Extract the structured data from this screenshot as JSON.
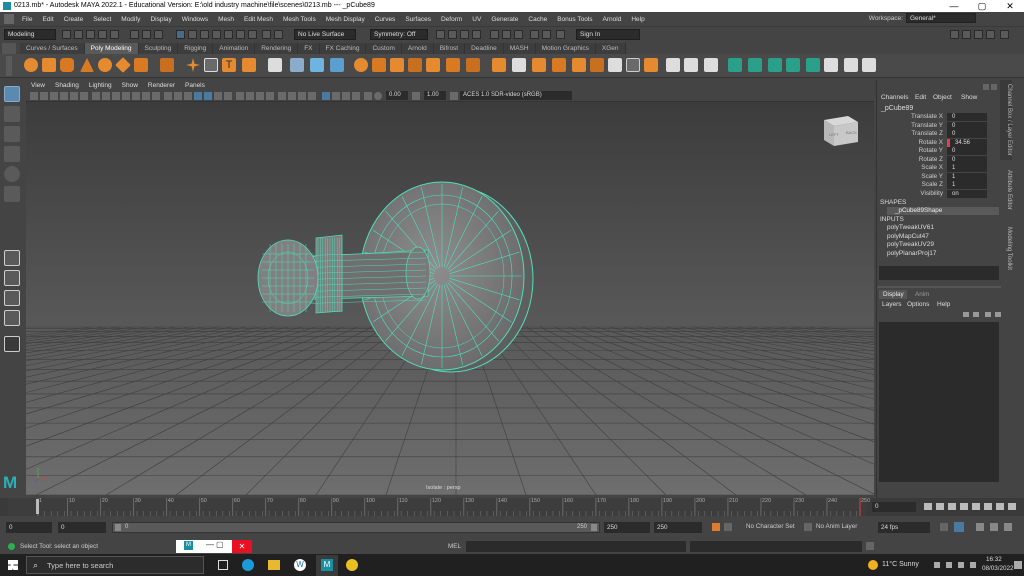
{
  "window": {
    "title": "0213.mb* - Autodesk MAYA 2022.1 - Educational Version: E:\\old industry machine\\file\\scenes\\0213.mb  ---  _pCube89",
    "minimize": "—",
    "maximize": "▢",
    "close": "✕"
  },
  "menubar": {
    "items": [
      "File",
      "Edit",
      "Create",
      "Select",
      "Modify",
      "Display",
      "Windows",
      "Mesh",
      "Edit Mesh",
      "Mesh Tools",
      "Mesh Display",
      "Curves",
      "Surfaces",
      "Deform",
      "UV",
      "Generate",
      "Cache",
      "Bonus Tools",
      "Arnold",
      "Help"
    ],
    "workspace_label": "Workspace:",
    "workspace_value": "General*"
  },
  "statusline": {
    "mode": "Modeling",
    "live_surface": "No Live Surface",
    "symmetry": "Symmetry: Off",
    "signin": "Sign In"
  },
  "shelf": {
    "tabs": [
      "Curves / Surfaces",
      "Poly Modeling",
      "Sculpting",
      "Rigging",
      "Animation",
      "Rendering",
      "FX",
      "FX Caching",
      "Custom",
      "Arnold",
      "Bifrost",
      "Deadline",
      "MASH",
      "Motion Graphics",
      "XGen"
    ],
    "active_tab": "Poly Modeling"
  },
  "viewport": {
    "menu": [
      "View",
      "Shading",
      "Lighting",
      "Show",
      "Renderer",
      "Panels"
    ],
    "exposure": "0.00",
    "gamma": "1.00",
    "colorspace": "ACES 1.0 SDR-video (sRGB)",
    "camera_label": "Isolate : persp",
    "viewcube_left": "LEFT",
    "viewcube_back": "BACK"
  },
  "channelbox": {
    "tabs": [
      "Channels",
      "Edit",
      "Object",
      "Show"
    ],
    "object_name": "_pCube89",
    "attributes": [
      {
        "name": "Translate X",
        "value": "0"
      },
      {
        "name": "Translate Y",
        "value": "0"
      },
      {
        "name": "Translate Z",
        "value": "0"
      },
      {
        "name": "Rotate X",
        "value": "34.56"
      },
      {
        "name": "Rotate Y",
        "value": "0"
      },
      {
        "name": "Rotate Z",
        "value": "0"
      },
      {
        "name": "Scale X",
        "value": "1"
      },
      {
        "name": "Scale Y",
        "value": "1"
      },
      {
        "name": "Scale Z",
        "value": "1"
      },
      {
        "name": "Visibility",
        "value": "on"
      }
    ],
    "shapes_header": "SHAPES",
    "shape_name": "_pCube89Shape",
    "inputs_header": "INPUTS",
    "inputs": [
      "polyTweakUV61",
      "polyMapCut47",
      "polyTweakUV29",
      "polyPlanarProj17"
    ],
    "layer_tabs": [
      "Display",
      "Anim"
    ],
    "layer_menu": [
      "Layers",
      "Options",
      "Help"
    ],
    "side_tabs": [
      "Channel Box / Layer Editor",
      "Attribute Editor",
      "Modeling Toolkit"
    ]
  },
  "timeline": {
    "ticks": [
      "1",
      "10",
      "20",
      "30",
      "40",
      "50",
      "60",
      "70",
      "80",
      "90",
      "100",
      "110",
      "120",
      "130",
      "140",
      "150",
      "160",
      "170",
      "180",
      "190",
      "200",
      "210",
      "220",
      "230",
      "240",
      "250"
    ],
    "current_frame": "0",
    "current_field": "0"
  },
  "range": {
    "start": "0",
    "start2": "0",
    "slider_start": "0",
    "slider_end": "250",
    "end": "250",
    "end2": "250",
    "character_set": "No Character Set",
    "anim_layer": "No Anim Layer",
    "fps": "24 fps"
  },
  "cmdline": {
    "help_text": "Select Tool: select an object",
    "mel_label": "MEL"
  },
  "taskbar": {
    "search_placeholder": "Type here to search",
    "weather": "11°C  Sunny",
    "time": "16:32",
    "date": "08/03/2022"
  }
}
